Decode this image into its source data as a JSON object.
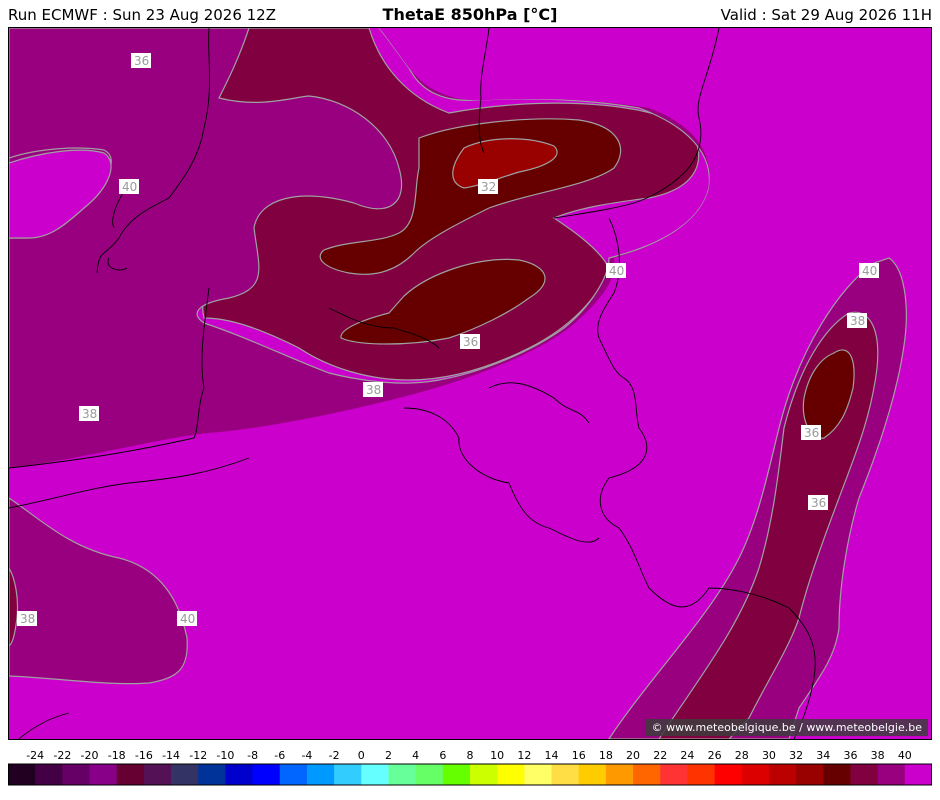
{
  "header": {
    "run": "Run ECMWF : Sun 23 Aug 2026 12Z",
    "title": "ThetaE 850hPa [°C]",
    "valid": "Valid : Sat 29 Aug 2026 11H"
  },
  "credit": "© www.meteobelgique.be / www.meteobelgie.be",
  "map": {
    "fill_colors": {
      "32_34": "#990000",
      "34_36": "#660000",
      "36_38": "#800040",
      "38_40": "#990080",
      "above_40": "#cc00cc"
    },
    "contour_color": "#a0a0a0",
    "border_color": "#000000",
    "contour_labels": [
      "36",
      "40",
      "32",
      "40",
      "40",
      "38",
      "36",
      "38",
      "38",
      "36",
      "36",
      "38",
      "40"
    ]
  },
  "legend": {
    "ticks": [
      "-24",
      "-22",
      "-20",
      "-18",
      "-16",
      "-14",
      "-12",
      "-10",
      "-8",
      "-6",
      "-4",
      "-2",
      "0",
      "2",
      "4",
      "6",
      "8",
      "10",
      "12",
      "14",
      "16",
      "18",
      "20",
      "22",
      "24",
      "26",
      "28",
      "30",
      "32",
      "34",
      "36",
      "38",
      "40"
    ],
    "colors": [
      "#220022",
      "#440044",
      "#660066",
      "#880088",
      "#660033",
      "#551155",
      "#333366",
      "#003399",
      "#0000cc",
      "#0000ff",
      "#0066ff",
      "#0099ff",
      "#33ccff",
      "#66ffff",
      "#66ff99",
      "#66ff66",
      "#66ff00",
      "#ccff00",
      "#ffff00",
      "#ffff66",
      "#ffdd44",
      "#ffcc00",
      "#ff9900",
      "#ff6600",
      "#ff3333",
      "#ff3300",
      "#ff0000",
      "#dd0000",
      "#bb0000",
      "#990000",
      "#660000",
      "#800040",
      "#990080",
      "#cc00cc"
    ]
  }
}
